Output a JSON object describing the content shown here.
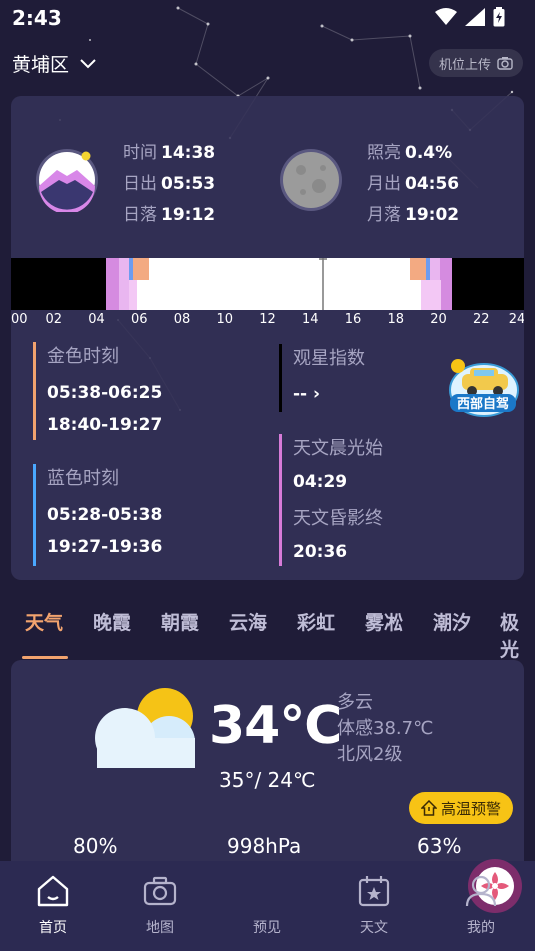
{
  "status": {
    "time": "2:43"
  },
  "header": {
    "location": "黄埔区",
    "upload_label": "机位上传"
  },
  "sun": {
    "time_label": "时间",
    "time_value": "14:38",
    "rise_label": "日出",
    "rise_value": "05:53",
    "set_label": "日落",
    "set_value": "19:12"
  },
  "moon": {
    "illum_label": "照亮",
    "illum_value": "0.4%",
    "rise_label": "月出",
    "rise_value": "04:56",
    "set_label": "月落",
    "set_value": "19:02"
  },
  "timeline": {
    "hours": [
      "00",
      "02",
      "04",
      "06",
      "08",
      "10",
      "12",
      "14",
      "16",
      "18",
      "20",
      "22",
      "24"
    ],
    "current_hour": 14.63
  },
  "golden": {
    "title": "金色时刻",
    "morning": "05:38-06:25",
    "evening": "18:40-19:27"
  },
  "blue": {
    "title": "蓝色时刻",
    "morning": "05:28-05:38",
    "evening": "19:27-19:36"
  },
  "stargazing": {
    "title": "观星指数",
    "value": "-- ›"
  },
  "astro_twilight": {
    "dawn_title": "天文晨光始",
    "dawn_value": "04:29",
    "dusk_title": "天文昏影终",
    "dusk_value": "20:36"
  },
  "badge": {
    "text": "西部自驾"
  },
  "tabs": [
    "天气",
    "晚霞",
    "朝霞",
    "云海",
    "彩虹",
    "雾凇",
    "潮汐",
    "极光"
  ],
  "weather": {
    "temp": "34℃",
    "range": "35°/ 24℃",
    "condition": "多云",
    "feels_like": "体感38.7℃",
    "wind": "北风2级",
    "warning": "高温预警",
    "stats": [
      "80%",
      "998hPa",
      "63%"
    ]
  },
  "nav": [
    {
      "label": "首页",
      "icon": "home-icon"
    },
    {
      "label": "地图",
      "icon": "camera-icon"
    },
    {
      "label": "预见",
      "icon": "flower-icon"
    },
    {
      "label": "天文",
      "icon": "calendar-star-icon"
    },
    {
      "label": "我的",
      "icon": "user-icon"
    }
  ],
  "colors": {
    "accent": "#f2a36e",
    "golden": "#f2a36e",
    "blue": "#4aa8ff",
    "astro": "#d77bd8",
    "warning": "#f7c315"
  }
}
